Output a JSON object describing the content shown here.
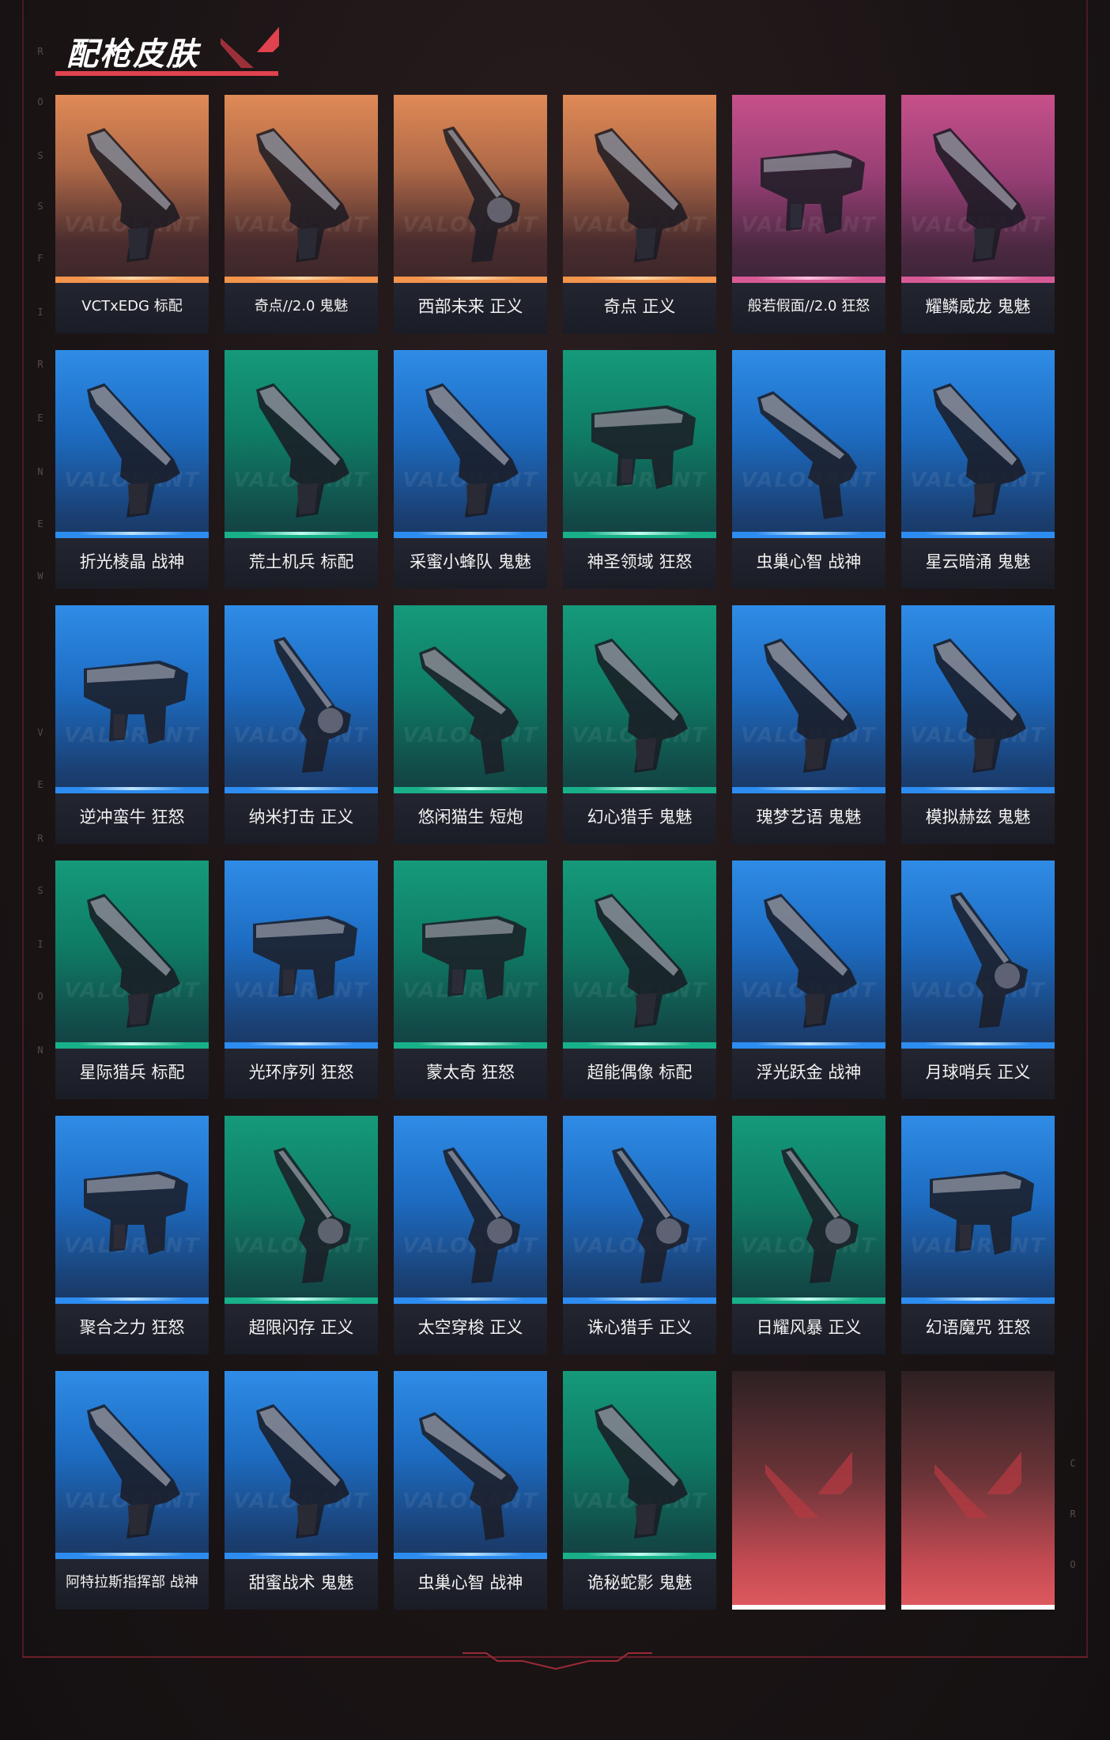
{
  "header": {
    "title": "配枪皮肤"
  },
  "side_letters_left": [
    "R",
    "O",
    "S",
    "S",
    "F",
    "I",
    "R",
    "E",
    "N",
    "E",
    "W",
    "V",
    "E",
    "R",
    "S",
    "I",
    "O",
    "N"
  ],
  "side_letters_right": [
    "C",
    "R",
    "O"
  ],
  "watermark": "VALORANT",
  "colors": {
    "accent": "#e0424e",
    "orange": "#e08a56",
    "pink": "#c7508a",
    "blue": "#2f8ce6",
    "green": "#159a7a"
  },
  "skins": [
    {
      "name": "VCTxEDG 标配",
      "tier": "orange",
      "icon": "pistol-icon"
    },
    {
      "name": "奇点//2.0 鬼魅",
      "tier": "orange",
      "icon": "pistol-icon"
    },
    {
      "name": "西部未来 正义",
      "tier": "orange",
      "icon": "revolver-icon"
    },
    {
      "name": "奇点 正义",
      "tier": "orange",
      "icon": "pistol-icon"
    },
    {
      "name": "般若假面//2.0 狂怒",
      "tier": "pink",
      "icon": "smg-pistol-icon"
    },
    {
      "name": "耀鳞威龙 鬼魅",
      "tier": "pink",
      "icon": "pistol-icon"
    },
    {
      "name": "折光棱晶 战神",
      "tier": "blue",
      "icon": "pistol-icon"
    },
    {
      "name": "荒土机兵 标配",
      "tier": "green",
      "icon": "pistol-icon"
    },
    {
      "name": "采蜜小蜂队 鬼魅",
      "tier": "blue",
      "icon": "pistol-icon"
    },
    {
      "name": "神圣领域 狂怒",
      "tier": "green",
      "icon": "smg-pistol-icon"
    },
    {
      "name": "虫巢心智 战神",
      "tier": "blue",
      "icon": "shotgun-pistol-icon"
    },
    {
      "name": "星云暗涌 鬼魅",
      "tier": "blue",
      "icon": "pistol-icon"
    },
    {
      "name": "逆冲蛮牛 狂怒",
      "tier": "blue",
      "icon": "smg-pistol-icon"
    },
    {
      "name": "纳米打击 正义",
      "tier": "blue",
      "icon": "revolver-icon"
    },
    {
      "name": "悠闲猫生 短炮",
      "tier": "green",
      "icon": "shotgun-pistol-icon"
    },
    {
      "name": "幻心猎手 鬼魅",
      "tier": "green",
      "icon": "pistol-icon"
    },
    {
      "name": "瑰梦艺语 鬼魅",
      "tier": "blue",
      "icon": "pistol-icon"
    },
    {
      "name": "模拟赫兹 鬼魅",
      "tier": "blue",
      "icon": "pistol-icon"
    },
    {
      "name": "星际猎兵 标配",
      "tier": "green",
      "icon": "pistol-icon"
    },
    {
      "name": "光环序列 狂怒",
      "tier": "blue",
      "icon": "smg-pistol-icon"
    },
    {
      "name": "蒙太奇 狂怒",
      "tier": "green",
      "icon": "smg-pistol-icon"
    },
    {
      "name": "超能偶像 标配",
      "tier": "green",
      "icon": "pistol-icon"
    },
    {
      "name": "浮光跃金 战神",
      "tier": "blue",
      "icon": "pistol-icon"
    },
    {
      "name": "月球哨兵 正义",
      "tier": "blue",
      "icon": "revolver-icon"
    },
    {
      "name": "聚合之力 狂怒",
      "tier": "blue",
      "icon": "smg-pistol-icon"
    },
    {
      "name": "超限闪存 正义",
      "tier": "green",
      "icon": "revolver-icon"
    },
    {
      "name": "太空穿梭 正义",
      "tier": "blue",
      "icon": "revolver-icon"
    },
    {
      "name": "诛心猎手 正义",
      "tier": "blue",
      "icon": "revolver-icon"
    },
    {
      "name": "日耀风暴 正义",
      "tier": "green",
      "icon": "revolver-icon"
    },
    {
      "name": "幻语魔咒 狂怒",
      "tier": "blue",
      "icon": "smg-pistol-icon"
    },
    {
      "name": "阿特拉斯指挥部 战神",
      "tier": "blue",
      "icon": "pistol-icon"
    },
    {
      "name": "甜蜜战术 鬼魅",
      "tier": "blue",
      "icon": "pistol-icon"
    },
    {
      "name": "虫巢心智 战神",
      "tier": "blue",
      "icon": "shotgun-pistol-icon"
    },
    {
      "name": "诡秘蛇影 鬼魅",
      "tier": "green",
      "icon": "pistol-icon"
    },
    {
      "name": "",
      "tier": "empty",
      "icon": "valorant-logo-icon"
    },
    {
      "name": "",
      "tier": "empty",
      "icon": "valorant-logo-icon"
    }
  ]
}
